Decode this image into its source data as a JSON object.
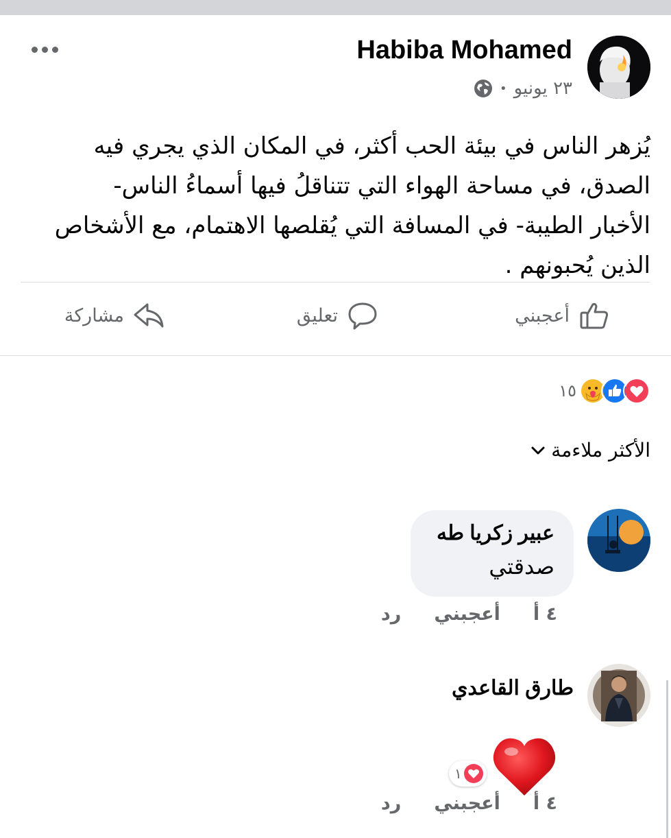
{
  "post": {
    "author": "Habiba Mohamed",
    "date": "٢٣ يونيو",
    "separator": "•",
    "privacy_icon": "globe-icon",
    "text_lines": [
      "يُزهر الناس في بيئة الحب أكثر، في المكان الذي يجري فيه",
      "الصدق، في مساحة الهواء التي تتناقلُ فيها أسماءُ الناس-",
      "الأخبار الطيبة- في المسافة التي يُقلصها الاهتمام، مع الأشخاص",
      "الذين يُحبونهم ."
    ]
  },
  "actions": {
    "like": "أعجبني",
    "comment": "تعليق",
    "share": "مشاركة"
  },
  "reactions": {
    "icons": [
      "love-icon",
      "like-icon",
      "care-icon"
    ],
    "count": "١٥"
  },
  "sort": {
    "label": "الأكثر ملاءمة"
  },
  "comments": [
    {
      "author": "عبير زكريا طه",
      "text": "صدقتي",
      "time": "٤ أ",
      "like": "أعجبني",
      "reply": "رد"
    },
    {
      "author": "طارق القاعدي",
      "sticker": "heart-sticker",
      "reaction_count": "١",
      "time": "٤ أ",
      "like": "أعجبني",
      "reply": "رد"
    }
  ],
  "colors": {
    "secondary_text": "#65676b",
    "bubble": "#f0f2f5",
    "like_blue": "#1877f2",
    "love_red": "#f33e58"
  }
}
